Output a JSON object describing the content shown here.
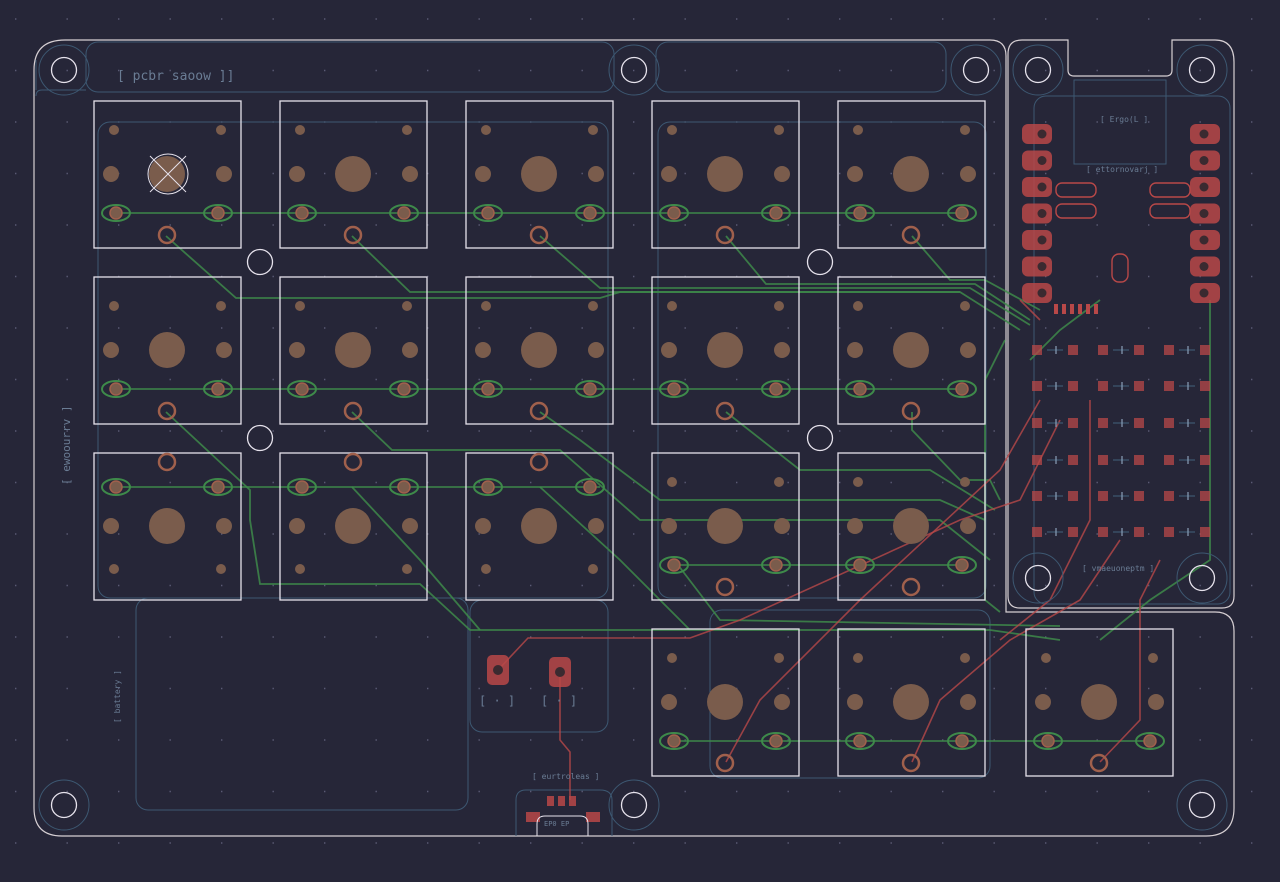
{
  "view": {
    "title_label": "[ pcbr saoow ]]",
    "side_label": "[ ewoourrv ]",
    "battery_label": "[ battery ]",
    "mcu_label": "[ Ergo(L ]",
    "mcu_footprint_label": "[ ettornovarj ]",
    "matrix_label": "[ vmaeuoneptm ]",
    "connector_label": "[ eurtroleas ]",
    "connector_pins": "EP0  EP",
    "jumper_labels": [
      "[ · ]",
      "[ · ]"
    ]
  },
  "colors": {
    "background": "#262638",
    "board_edge": "#d6cfd3",
    "silkscreen": "#e6e2ec",
    "fab_outline": "#3d5872",
    "copper_front": "#b84848",
    "copper_back": "#3e8a4a",
    "pad": "#7a5c4c",
    "via": "#a0604c"
  }
}
